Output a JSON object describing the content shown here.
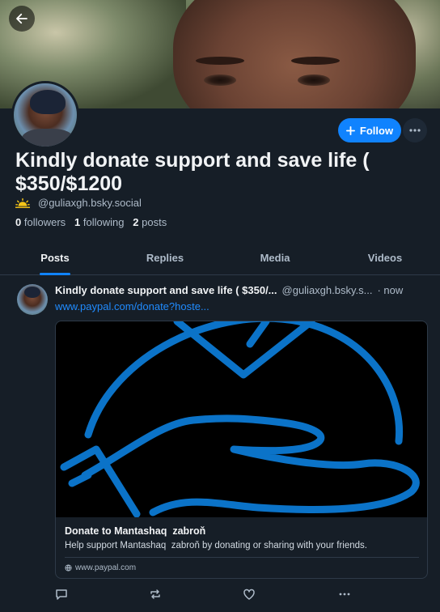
{
  "profile": {
    "display_name": "Kindly donate support and save life ( $350/$1200",
    "handle": "@guliaxgh.bsky.social",
    "followers_count": "0",
    "followers_label": "followers",
    "following_count": "1",
    "following_label": "following",
    "posts_count": "2",
    "posts_label": "posts",
    "follow_label": "Follow"
  },
  "tabs": [
    {
      "label": "Posts",
      "active": true
    },
    {
      "label": "Replies",
      "active": false
    },
    {
      "label": "Media",
      "active": false
    },
    {
      "label": "Videos",
      "active": false
    }
  ],
  "post": {
    "author_name": "Kindly donate support and save life ( $350/...",
    "author_handle": "@guliaxgh.bsky.s...",
    "time": "· now",
    "link_text": "www.paypal.com/donate?hoste...",
    "card": {
      "title": "Donate to Mantashaq  zabroň",
      "description": "Help support Mantashaq  zabroň by donating or sharing with your friends.",
      "domain": "www.paypal.com"
    }
  },
  "colors": {
    "background": "#161e27",
    "accent": "#1083fe",
    "link": "#208bfe",
    "muted_text": "#aebbc9",
    "card_art_blue": "#0b73c8"
  },
  "icons": [
    "back-arrow-icon",
    "plus-icon",
    "ellipsis-icon",
    "sun-icon",
    "globe-icon",
    "reply-icon",
    "repost-icon",
    "like-icon",
    "post-menu-icon"
  ]
}
